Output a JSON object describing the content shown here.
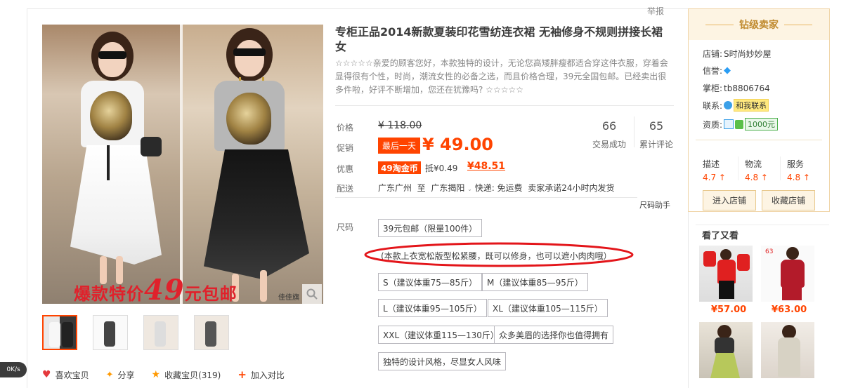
{
  "report": "举报",
  "gallery": {
    "promo_text_a": "爆款特价",
    "promo_text_big": "49",
    "promo_text_b": "元包邮",
    "watermark": "佳佳旗",
    "thumb_count": 4
  },
  "product": {
    "title": "专柜正品2014新款夏装印花雪纺连衣裙 无袖修身不规则拼接长裙女",
    "subtitle": "☆☆☆☆☆亲爱的顾客您好，本款独特的设计，无论您高矮胖瘦都适合穿这件衣服，穿着会显得很有个性，时尚，潮流女性的必备之选，而且价格合理，39元全国包邮。已经卖出很多件啦，好评不断增加，您还在犹豫吗? ☆☆☆☆☆"
  },
  "price": {
    "label": "价格",
    "original": "¥ 118.00",
    "promo_label": "促销",
    "promo_badge": "最后一天",
    "promo_price": "¥ 49.00",
    "discount_label": "优惠",
    "coin_badge": "49淘金币",
    "coin_deduct": "抵¥0.49",
    "coin_final": "¥48.51"
  },
  "stats": {
    "deals_num": "66",
    "deals_label": "交易成功",
    "reviews_num": "65",
    "reviews_label": "累计评论"
  },
  "delivery": {
    "label": "配送",
    "from": "广东广州",
    "to_word": "至",
    "to": "广东揭阳",
    "express": "快递: 免运费",
    "promise": "卖家承诺24小时内发货"
  },
  "size": {
    "label": "尺码",
    "helper": "尺码助手",
    "options": [
      "39元包邮（限量100件）",
      "(本款上衣宽松版型松紧腰，既可以修身，也可以遮小肉肉哦）",
      "S（建议体重75—85斤）",
      "M（建议体重85—95斤）",
      "L（建议体重95—105斤）",
      "XL（建议体重105—115斤）",
      "XXL（建议体重115—130斤）",
      "众多美眉的选择你也值得拥有",
      "独特的设计风格，尽显女人风味"
    ]
  },
  "actions": {
    "like": "喜欢宝贝",
    "share": "分享",
    "collect": "收藏宝贝(319)",
    "compare": "加入对比"
  },
  "speed": "0K/s",
  "seller": {
    "level": "钻级卖家",
    "shop_label": "店铺:",
    "shop_name": "S时尚妙妙屋",
    "credit_label": "信誉:",
    "owner_label": "掌柜:",
    "owner": "tb8806764",
    "contact_label": "联系:",
    "contact_btn": "和我联系",
    "qual_label": "资质:",
    "deposit": "1000元",
    "ratings": [
      {
        "label": "描述",
        "value": "4.7"
      },
      {
        "label": "物流",
        "value": "4.8"
      },
      {
        "label": "服务",
        "value": "4.8"
      }
    ],
    "enter_shop": "进入店铺",
    "collect_shop": "收藏店铺"
  },
  "recommend": {
    "title": "看了又看",
    "items": [
      {
        "price": "¥57.00"
      },
      {
        "price": "¥63.00",
        "tag": "63"
      },
      {
        "price": ""
      },
      {
        "price": ""
      }
    ]
  },
  "colors": {
    "accent": "#ff4400",
    "ellipse": "#e3151a"
  }
}
